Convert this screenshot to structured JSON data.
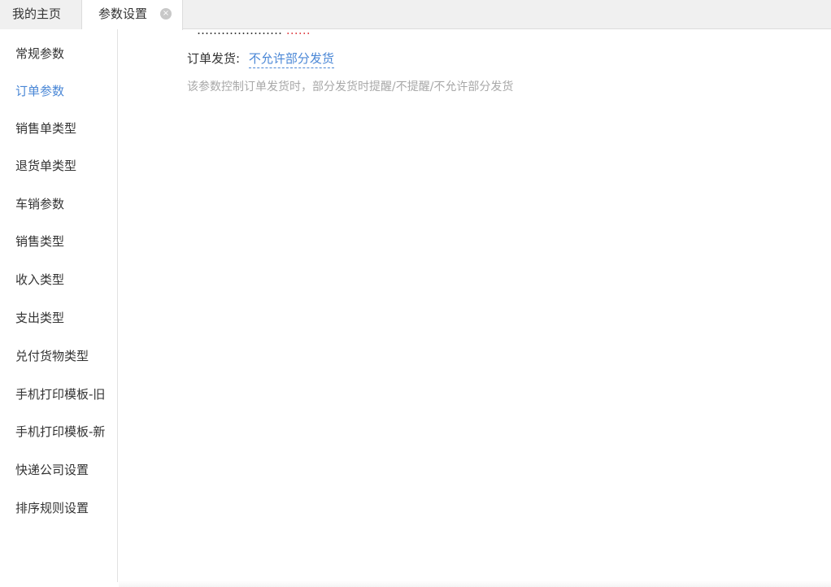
{
  "tabs": {
    "home_label": "我的主页",
    "params_label": "参数设置",
    "close_glyph": "×"
  },
  "sidebar": {
    "items": [
      {
        "label": "常规参数"
      },
      {
        "label": "订单参数",
        "active": true
      },
      {
        "label": "销售单类型"
      },
      {
        "label": "退货单类型"
      },
      {
        "label": "车销参数"
      },
      {
        "label": "销售类型"
      },
      {
        "label": "收入类型"
      },
      {
        "label": "支出类型"
      },
      {
        "label": "兑付货物类型"
      },
      {
        "label": "手机打印模板-旧"
      },
      {
        "label": "手机打印模板-新"
      },
      {
        "label": "快递公司设置"
      },
      {
        "label": "排序规则设置"
      }
    ]
  },
  "main": {
    "cutoff_label": "…………………",
    "cutoff_value": "……",
    "setting": {
      "label": "订单发货:",
      "value": "不允许部分发货",
      "description": "该参数控制订单发货时，部分发货时提醒/不提醒/不允许部分发货"
    }
  },
  "colors": {
    "accent": "#4a87d6",
    "muted": "#a8a8a8",
    "warning": "#e0454a"
  }
}
